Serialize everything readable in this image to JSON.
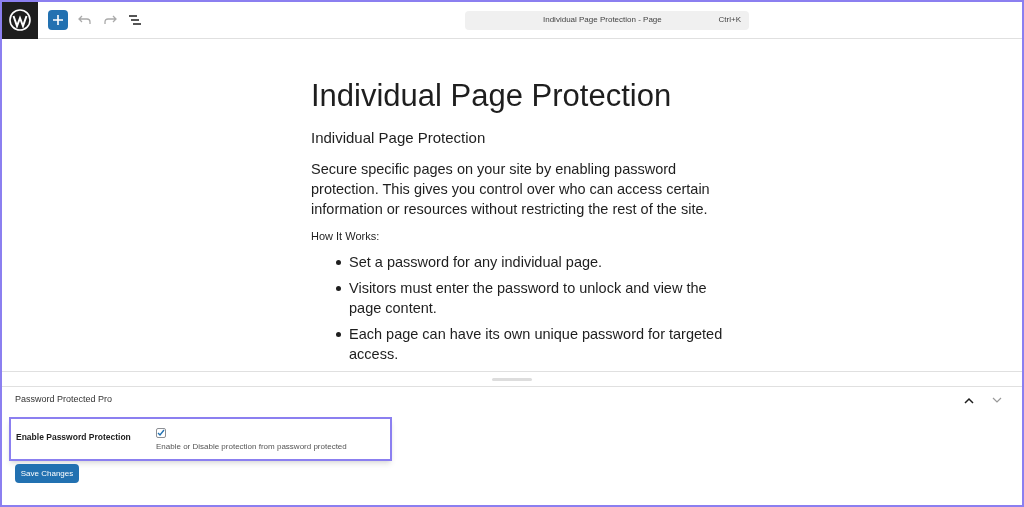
{
  "toolbar": {
    "document_title": "Individual Page Protection - Page",
    "shortcut": "Ctrl+K"
  },
  "content": {
    "title": "Individual Page Protection",
    "subtitle": "Individual Page Protection",
    "paragraph": "Secure specific pages on your site by enabling password protection. This gives you control over who can access certain information or resources without restricting the rest of the site.",
    "label": "How It Works:",
    "items": [
      "Set a password for any individual page.",
      "Visitors must enter the password to unlock and view the page content.",
      "Each page can have its own unique password for targeted access."
    ]
  },
  "panel": {
    "title": "Password Protected Pro",
    "setting": {
      "label": "Enable Password Protection",
      "checked": true,
      "description": "Enable or Disable protection from password protected"
    },
    "button": "Save Changes"
  }
}
